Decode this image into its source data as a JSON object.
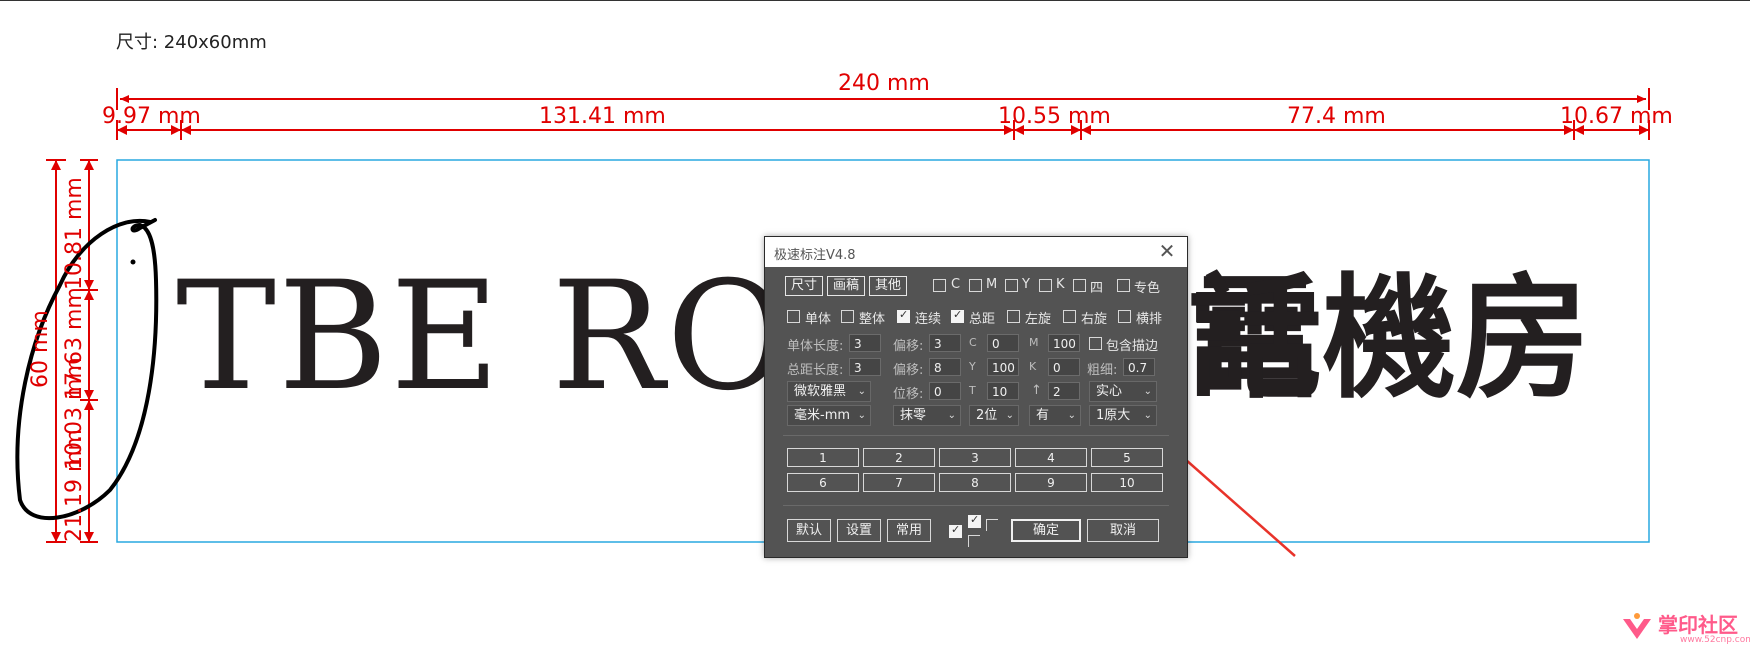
{
  "document": {
    "size_label": "尺寸: 240x60mm",
    "dimensions": {
      "total_width": "240 mm",
      "seg1": "9.97 mm",
      "seg2": "131.41 mm",
      "seg3": "10.55 mm",
      "seg4": "77.4 mm",
      "seg5": "10.67 mm",
      "total_height": "60 mm",
      "v_seg_top": "10.81 mm",
      "v_seg_mid": "17.63 mm",
      "v_seg_mid2": "10.03 mm",
      "v_seg_bottom": "21.19 mm"
    },
    "artwork_latin": "TBE ROO",
    "artwork_cjk": "話機房",
    "artwork_cjk_partial": "電",
    "colors": {
      "dimension": "#e00000",
      "frame": "#29a8e0",
      "arrow": "#e8332a"
    }
  },
  "dialog": {
    "title": "极速标注V4.8",
    "close": "✕",
    "tabs": [
      "尺寸",
      "画稿",
      "其他"
    ],
    "color_checks": [
      "C",
      "M",
      "Y",
      "K",
      "四",
      "专色"
    ],
    "options": [
      {
        "label": "单体",
        "checked": false
      },
      {
        "label": "整体",
        "checked": false
      },
      {
        "label": "连续",
        "checked": true
      },
      {
        "label": "总距",
        "checked": true
      },
      {
        "label": "左旋",
        "checked": false
      },
      {
        "label": "右旋",
        "checked": false
      },
      {
        "label": "横排",
        "checked": false
      }
    ],
    "row1": {
      "single_length_label": "单体长度:",
      "single_length": "3",
      "offset_label": "偏移:",
      "offset": "3",
      "c_label": "C",
      "c": "0",
      "m_label": "M",
      "m": "100",
      "include_stroke_label": "包含描边"
    },
    "row2": {
      "total_length_label": "总距长度:",
      "total_length": "3",
      "offset_label": "偏移:",
      "offset": "8",
      "y_label": "Y",
      "y": "100",
      "k_label": "K",
      "k": "0",
      "thickness_label": "粗细:",
      "thickness": "0.7"
    },
    "row3": {
      "font": "微软雅黑",
      "shift_label": "位移:",
      "shift": "0",
      "t_label": "T",
      "t": "10",
      "arrow_label": "↑",
      "arrow_value": "2",
      "style": "实心"
    },
    "row4": {
      "unit": "毫米-mm",
      "rounding": "抹零",
      "decimals": "2位",
      "has": "有",
      "scale": "1原大"
    },
    "presets": [
      "1",
      "2",
      "3",
      "4",
      "5",
      "6",
      "7",
      "8",
      "9",
      "10"
    ],
    "footer": {
      "default": "默认",
      "settings": "设置",
      "common": "常用",
      "ok": "确定",
      "cancel": "取消"
    }
  },
  "watermark": {
    "text": "掌印社区",
    "url": "www.52cnp.com"
  }
}
